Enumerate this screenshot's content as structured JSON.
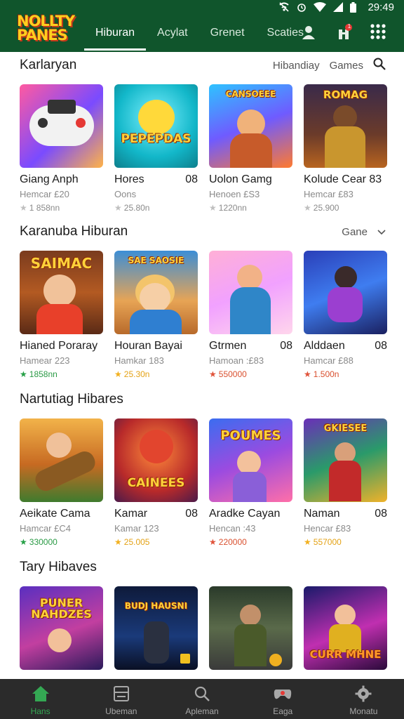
{
  "status": {
    "time": "29:49"
  },
  "brand": {
    "line1": "NOLLTY",
    "line2": "PANES"
  },
  "nav": {
    "tabs": [
      {
        "label": "Hiburan",
        "active": true
      },
      {
        "label": "Acylat"
      },
      {
        "label": "Grenet"
      },
      {
        "label": "Scaties"
      }
    ],
    "notification_badge": "1"
  },
  "sections": [
    {
      "title": "Karlaryan",
      "actions": [
        "Hibandiay",
        "Games"
      ],
      "items": [
        {
          "name": "Giang Anph",
          "badge": "",
          "sub": "Hemcar £20",
          "rating": "1 858nn",
          "star": "grey",
          "art": "controller",
          "art_text": ""
        },
        {
          "name": "Hores",
          "badge": "08",
          "sub": "Oons",
          "rating": "25.80n",
          "star": "grey",
          "art": "emoji",
          "art_text": "PEPEPDAS"
        },
        {
          "name": "Uolon  Gamg",
          "badge": "",
          "sub": "Henoen £S3",
          "rating": "1220nn",
          "star": "grey",
          "art": "cowboy",
          "art_text": "CANSOEEE"
        },
        {
          "name": "Kolude Cear 83",
          "badge": "",
          "sub": "Hemcar £83",
          "rating": "25.900",
          "star": "grey",
          "art": "warrior",
          "art_text": "ROMAG"
        }
      ]
    },
    {
      "title": "Karanuba Hiburan",
      "actions": [
        "Gane"
      ],
      "items": [
        {
          "name": "Hianed Poraray",
          "badge": "",
          "sub": "Hamear 223",
          "rating": "1858nn",
          "star": "green",
          "art": "boy-shop",
          "art_text": "SAIMAC"
        },
        {
          "name": "Houran Bayai",
          "badge": "",
          "sub": "Hamkar 183",
          "rating": "25.30n",
          "star": "yellow",
          "art": "boy-blond",
          "art_text": "SAE SAOSIE"
        },
        {
          "name": "Gtrmen",
          "badge": "08",
          "sub": "Hamoan :£83",
          "rating": "550000",
          "star": "red",
          "art": "kid-pink",
          "art_text": ""
        },
        {
          "name": "Alddaen",
          "badge": "08",
          "sub": "Hamcar £88",
          "rating": "1.500n",
          "star": "red",
          "art": "hero-purple",
          "art_text": ""
        }
      ]
    },
    {
      "title": "Nartutiag Hibares",
      "actions": [],
      "items": [
        {
          "name": "Aeikate Cama",
          "badge": "",
          "sub": "Hamcar £C4",
          "rating": "330000",
          "star": "green",
          "art": "cannon",
          "art_text": ""
        },
        {
          "name": "Kamar",
          "badge": "08",
          "sub": "Kamar 123",
          "rating": "25.005",
          "star": "yellow",
          "art": "robot",
          "art_text": "CAINEES"
        },
        {
          "name": "Aradke Cayan",
          "badge": "",
          "sub": "Hencan :43",
          "rating": "220000",
          "star": "red",
          "art": "pumes",
          "art_text": "POUMES"
        },
        {
          "name": "Naman",
          "badge": "08",
          "sub": "Hencar £83",
          "rating": "557000",
          "star": "yellow",
          "art": "dancer",
          "art_text": "GKIESEE"
        }
      ]
    },
    {
      "title": "Tary Hibaves",
      "actions": [],
      "items": [
        {
          "name": "",
          "badge": "",
          "sub": "",
          "rating": "",
          "star": "grey",
          "art": "puner",
          "art_text": "PUNER NAHDZES"
        },
        {
          "name": "",
          "badge": "",
          "sub": "",
          "rating": "",
          "star": "grey",
          "art": "soldier",
          "art_text": "BUDJ HAUSNI"
        },
        {
          "name": "",
          "badge": "",
          "sub": "",
          "rating": "",
          "star": "grey",
          "art": "street",
          "art_text": ""
        },
        {
          "name": "",
          "badge": "",
          "sub": "",
          "rating": "",
          "star": "grey",
          "art": "curr",
          "art_text": "CURR MHNE"
        }
      ]
    }
  ],
  "bottom_nav": [
    {
      "label": "Hans",
      "icon": "home-icon",
      "active": true
    },
    {
      "label": "Ubeman",
      "icon": "window-icon"
    },
    {
      "label": "Apleman",
      "icon": "search-icon"
    },
    {
      "label": "Eaga",
      "icon": "gamepad-icon"
    },
    {
      "label": "Monatu",
      "icon": "gear-icon"
    }
  ],
  "colors": {
    "header": "#10552c",
    "accent": "#34a853",
    "bottom_nav": "#2b2b2b"
  }
}
